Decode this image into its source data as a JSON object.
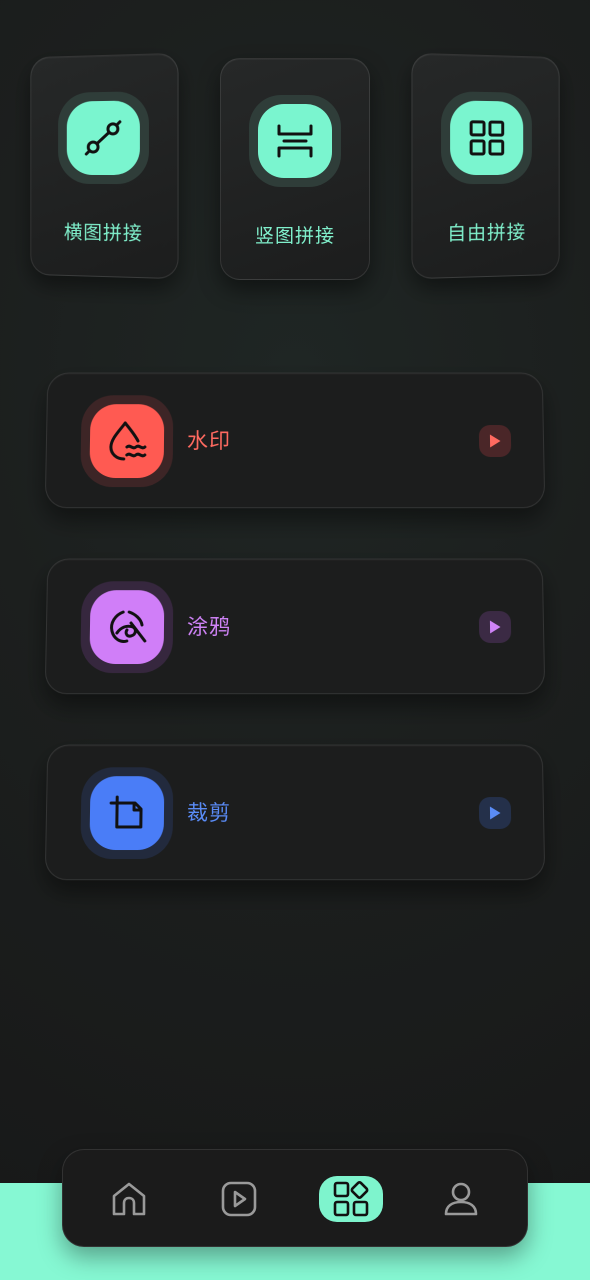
{
  "top_tools": [
    {
      "label": "横图拼接",
      "icon": "horizontal-stitch-icon"
    },
    {
      "label": "竖图拼接",
      "icon": "vertical-stitch-icon"
    },
    {
      "label": "自由拼接",
      "icon": "free-stitch-grid-icon"
    }
  ],
  "cards": [
    {
      "label": "水印",
      "icon": "watermark-drop-icon",
      "color": "#ff5a52",
      "ring": "#3d2526",
      "label_color": "#ff6a60",
      "play_bg": "#4a2628",
      "play_color": "#ff6a60"
    },
    {
      "label": "涂鸦",
      "icon": "doodle-brush-icon",
      "color": "#d07ef8",
      "ring": "#36273e",
      "label_color": "#cf83f7",
      "play_bg": "#3b2a44",
      "play_color": "#cf83f7"
    },
    {
      "label": "裁剪",
      "icon": "crop-icon",
      "color": "#4a7df7",
      "ring": "#222a3d",
      "label_color": "#5a8cf7",
      "play_bg": "#24304a",
      "play_color": "#5a8cf7"
    }
  ],
  "tabbar": {
    "items": [
      {
        "name": "home",
        "icon": "home-icon"
      },
      {
        "name": "video",
        "icon": "play-square-icon"
      },
      {
        "name": "tools",
        "icon": "grid-shapes-icon",
        "active": true
      },
      {
        "name": "profile",
        "icon": "user-icon"
      }
    ],
    "accent": "#7ef4cd"
  }
}
